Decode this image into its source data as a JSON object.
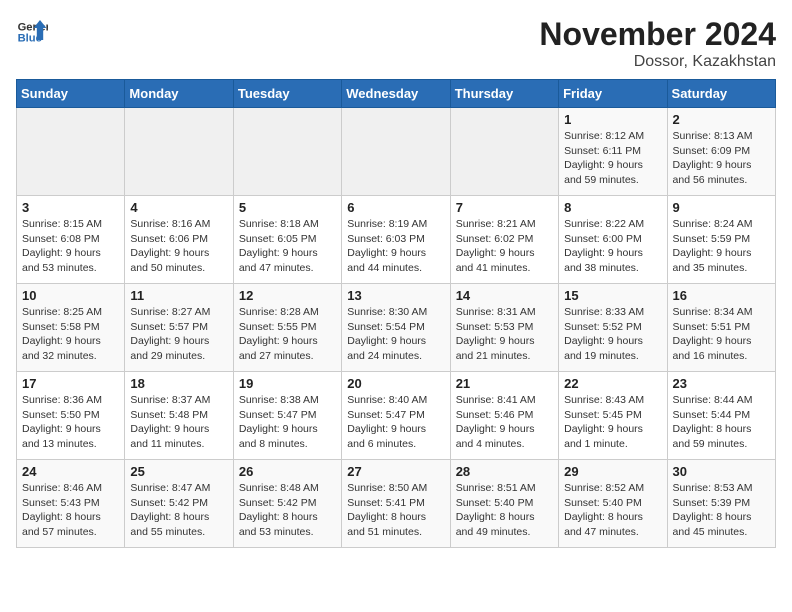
{
  "header": {
    "logo_line1": "General",
    "logo_line2": "Blue",
    "month_year": "November 2024",
    "location": "Dossor, Kazakhstan"
  },
  "days_of_week": [
    "Sunday",
    "Monday",
    "Tuesday",
    "Wednesday",
    "Thursday",
    "Friday",
    "Saturday"
  ],
  "weeks": [
    [
      {
        "day": "",
        "info": ""
      },
      {
        "day": "",
        "info": ""
      },
      {
        "day": "",
        "info": ""
      },
      {
        "day": "",
        "info": ""
      },
      {
        "day": "",
        "info": ""
      },
      {
        "day": "1",
        "info": "Sunrise: 8:12 AM\nSunset: 6:11 PM\nDaylight: 9 hours and 59 minutes."
      },
      {
        "day": "2",
        "info": "Sunrise: 8:13 AM\nSunset: 6:09 PM\nDaylight: 9 hours and 56 minutes."
      }
    ],
    [
      {
        "day": "3",
        "info": "Sunrise: 8:15 AM\nSunset: 6:08 PM\nDaylight: 9 hours and 53 minutes."
      },
      {
        "day": "4",
        "info": "Sunrise: 8:16 AM\nSunset: 6:06 PM\nDaylight: 9 hours and 50 minutes."
      },
      {
        "day": "5",
        "info": "Sunrise: 8:18 AM\nSunset: 6:05 PM\nDaylight: 9 hours and 47 minutes."
      },
      {
        "day": "6",
        "info": "Sunrise: 8:19 AM\nSunset: 6:03 PM\nDaylight: 9 hours and 44 minutes."
      },
      {
        "day": "7",
        "info": "Sunrise: 8:21 AM\nSunset: 6:02 PM\nDaylight: 9 hours and 41 minutes."
      },
      {
        "day": "8",
        "info": "Sunrise: 8:22 AM\nSunset: 6:00 PM\nDaylight: 9 hours and 38 minutes."
      },
      {
        "day": "9",
        "info": "Sunrise: 8:24 AM\nSunset: 5:59 PM\nDaylight: 9 hours and 35 minutes."
      }
    ],
    [
      {
        "day": "10",
        "info": "Sunrise: 8:25 AM\nSunset: 5:58 PM\nDaylight: 9 hours and 32 minutes."
      },
      {
        "day": "11",
        "info": "Sunrise: 8:27 AM\nSunset: 5:57 PM\nDaylight: 9 hours and 29 minutes."
      },
      {
        "day": "12",
        "info": "Sunrise: 8:28 AM\nSunset: 5:55 PM\nDaylight: 9 hours and 27 minutes."
      },
      {
        "day": "13",
        "info": "Sunrise: 8:30 AM\nSunset: 5:54 PM\nDaylight: 9 hours and 24 minutes."
      },
      {
        "day": "14",
        "info": "Sunrise: 8:31 AM\nSunset: 5:53 PM\nDaylight: 9 hours and 21 minutes."
      },
      {
        "day": "15",
        "info": "Sunrise: 8:33 AM\nSunset: 5:52 PM\nDaylight: 9 hours and 19 minutes."
      },
      {
        "day": "16",
        "info": "Sunrise: 8:34 AM\nSunset: 5:51 PM\nDaylight: 9 hours and 16 minutes."
      }
    ],
    [
      {
        "day": "17",
        "info": "Sunrise: 8:36 AM\nSunset: 5:50 PM\nDaylight: 9 hours and 13 minutes."
      },
      {
        "day": "18",
        "info": "Sunrise: 8:37 AM\nSunset: 5:48 PM\nDaylight: 9 hours and 11 minutes."
      },
      {
        "day": "19",
        "info": "Sunrise: 8:38 AM\nSunset: 5:47 PM\nDaylight: 9 hours and 8 minutes."
      },
      {
        "day": "20",
        "info": "Sunrise: 8:40 AM\nSunset: 5:47 PM\nDaylight: 9 hours and 6 minutes."
      },
      {
        "day": "21",
        "info": "Sunrise: 8:41 AM\nSunset: 5:46 PM\nDaylight: 9 hours and 4 minutes."
      },
      {
        "day": "22",
        "info": "Sunrise: 8:43 AM\nSunset: 5:45 PM\nDaylight: 9 hours and 1 minute."
      },
      {
        "day": "23",
        "info": "Sunrise: 8:44 AM\nSunset: 5:44 PM\nDaylight: 8 hours and 59 minutes."
      }
    ],
    [
      {
        "day": "24",
        "info": "Sunrise: 8:46 AM\nSunset: 5:43 PM\nDaylight: 8 hours and 57 minutes."
      },
      {
        "day": "25",
        "info": "Sunrise: 8:47 AM\nSunset: 5:42 PM\nDaylight: 8 hours and 55 minutes."
      },
      {
        "day": "26",
        "info": "Sunrise: 8:48 AM\nSunset: 5:42 PM\nDaylight: 8 hours and 53 minutes."
      },
      {
        "day": "27",
        "info": "Sunrise: 8:50 AM\nSunset: 5:41 PM\nDaylight: 8 hours and 51 minutes."
      },
      {
        "day": "28",
        "info": "Sunrise: 8:51 AM\nSunset: 5:40 PM\nDaylight: 8 hours and 49 minutes."
      },
      {
        "day": "29",
        "info": "Sunrise: 8:52 AM\nSunset: 5:40 PM\nDaylight: 8 hours and 47 minutes."
      },
      {
        "day": "30",
        "info": "Sunrise: 8:53 AM\nSunset: 5:39 PM\nDaylight: 8 hours and 45 minutes."
      }
    ]
  ]
}
